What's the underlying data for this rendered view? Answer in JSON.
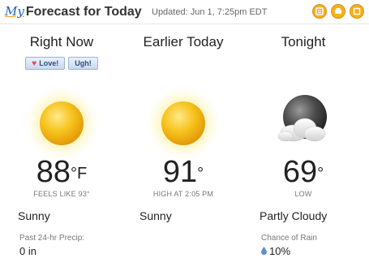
{
  "header": {
    "brand_my": "My",
    "brand_title": "Forecast for Today",
    "updated": "Updated: Jun 1, 7:25pm EDT",
    "icons": [
      "info-icon",
      "print-icon",
      "share-icon"
    ]
  },
  "columns": [
    {
      "title": "Right Now",
      "icon": "sun-icon",
      "temp": "88",
      "unit": "°F",
      "sub": "FEELS LIKE 93°",
      "condition": "Sunny",
      "stat_label": "Past 24-hr Precip:",
      "stat_value": "0 in",
      "rate": {
        "love": "Love!",
        "ugh": "Ugh!"
      }
    },
    {
      "title": "Earlier Today",
      "icon": "sun-icon",
      "temp": "91",
      "unit": "°",
      "sub": "HIGH AT 2:05 PM",
      "condition": "Sunny"
    },
    {
      "title": "Tonight",
      "icon": "moon-cloud-icon",
      "temp": "69",
      "unit": "°",
      "sub": "LOW",
      "condition": "Partly Cloudy",
      "stat_label": "Chance of Rain",
      "stat_value": "10%"
    }
  ],
  "colors": {
    "sun": "#f6c21a",
    "sun_glow": "#fff2a8",
    "accent": "#f3b21a",
    "brand": "#1a5fb4"
  }
}
